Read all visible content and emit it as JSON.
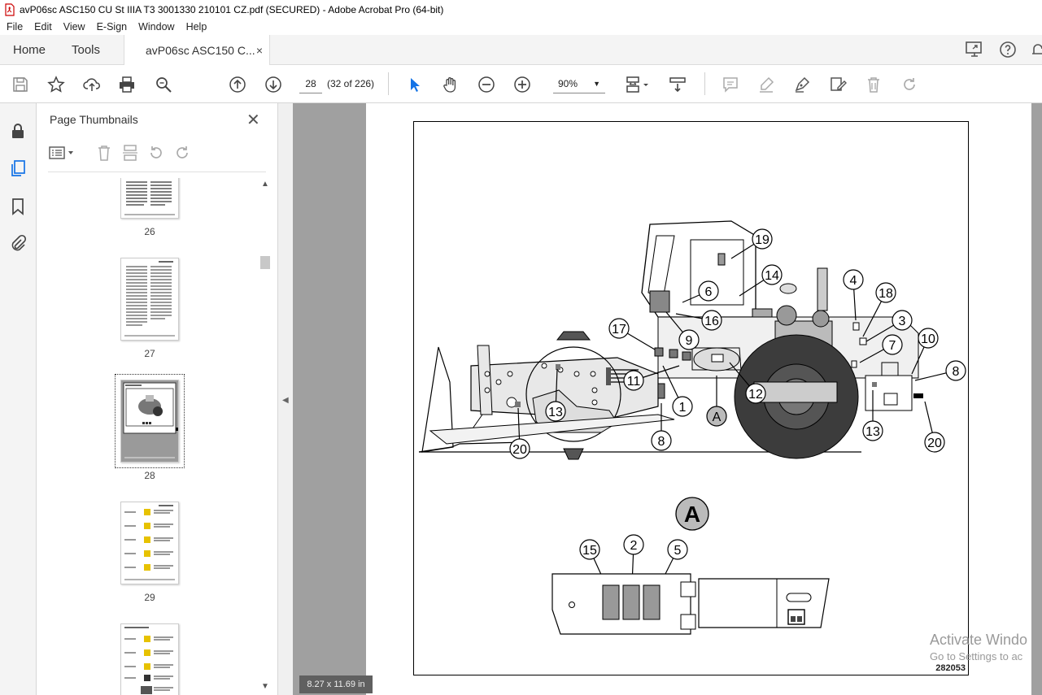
{
  "window": {
    "title": "avP06sc ASC150 CU St IIIA T3 3001330 210101 CZ.pdf (SECURED) - Adobe Acrobat Pro (64-bit)"
  },
  "menu": [
    "File",
    "Edit",
    "View",
    "E-Sign",
    "Window",
    "Help"
  ],
  "tabs": {
    "home": "Home",
    "tools": "Tools",
    "document": "avP06sc ASC150 C...",
    "close_glyph": "×"
  },
  "toolbar": {
    "page_number": "28",
    "page_count": "(32 of 226)",
    "zoom": "90%"
  },
  "icons": [
    "save-icon",
    "star-icon",
    "upload-icon",
    "print-icon",
    "search-icon",
    "page-up-icon",
    "page-down-icon",
    "select-cursor-icon",
    "hand-icon",
    "zoom-out-icon",
    "zoom-in-icon",
    "fit-page-icon",
    "scroll-mode-icon",
    "comment-icon",
    "highlight-icon",
    "sign-icon",
    "edit-icon",
    "delete-icon",
    "rotate-icon"
  ],
  "panel": {
    "title": "Page Thumbnails",
    "thumbnails": [
      {
        "label": "26"
      },
      {
        "label": "27"
      },
      {
        "label": "28"
      },
      {
        "label": "29"
      },
      {
        "label": ""
      }
    ]
  },
  "document": {
    "page_size": "8.27 x 11.69 in",
    "drawing_number": "282053",
    "view_label": "A",
    "callouts": [
      "19",
      "14",
      "6",
      "16",
      "9",
      "17",
      "4",
      "18",
      "3",
      "7",
      "10",
      "8",
      "11",
      "1",
      "12",
      "A",
      "13",
      "13",
      "20",
      "8",
      "20",
      "15",
      "2",
      "5"
    ]
  },
  "watermark": {
    "line1": "Activate Windo",
    "line2": "Go to Settings to ac"
  },
  "colors": {
    "doc_background": "#a0a0a0",
    "accent": "#1473e6"
  }
}
